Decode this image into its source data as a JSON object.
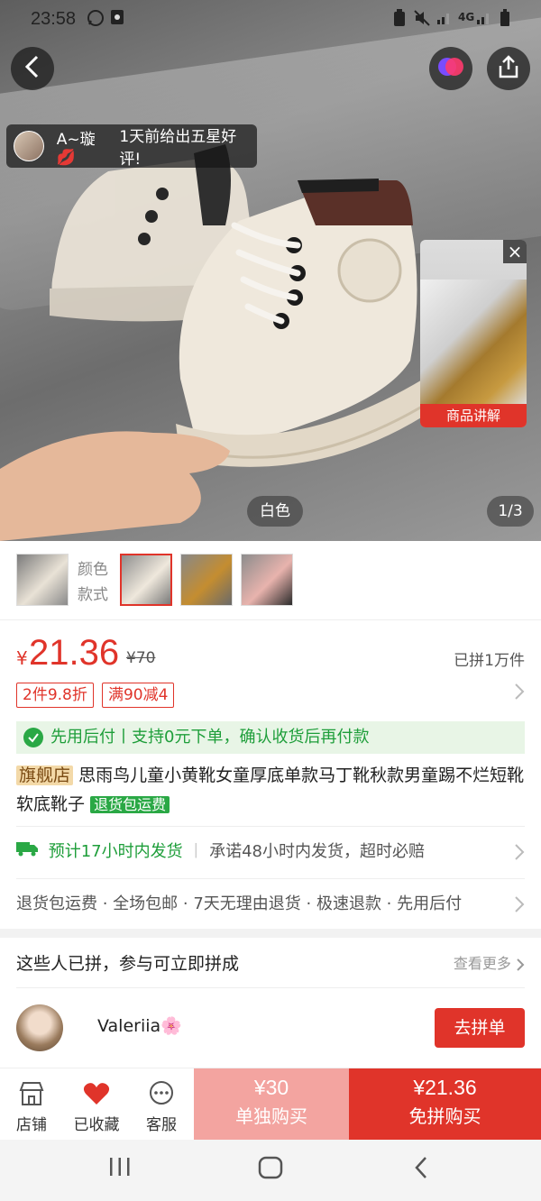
{
  "status_bar": {
    "time": "23:58",
    "icons": [
      "whatsapp-icon",
      "app-icon",
      "recycle-icon",
      "mute-icon",
      "signal-icon",
      "4g-icon",
      "signal-icon",
      "battery-icon"
    ],
    "network": "4G"
  },
  "hero": {
    "review_user": "A~璇💋",
    "review_text": "1天前给出五星好评!",
    "color_tag": "白色",
    "counter": "1/3",
    "video_label": "商品讲解",
    "video_close": "×"
  },
  "thumbs": {
    "label_line1": "颜色",
    "label_line2": "款式",
    "selected_index": 1
  },
  "price": {
    "currency": "¥",
    "current": "21.36",
    "original": "¥70",
    "group_count": "已拼1万件",
    "promos": [
      "2件9.8折",
      "满90减4"
    ]
  },
  "pay_banner": "先用后付丨支持0元下单，确认收货后再付款",
  "product": {
    "shop_tag": "旗舰店",
    "title": "思雨鸟儿童小黄靴女童厚底单款马丁靴秋款男童踢不烂短靴软底靴子",
    "return_tag": "退货包运费"
  },
  "shipping": {
    "estimate": "预计17小时内发货",
    "promise": "承诺48小时内发货，超时必赔"
  },
  "services": "退货包运费 · 全场包邮 · 7天无理由退货 · 极速退款 · 先用后付",
  "group_section": {
    "title": "这些人已拼，参与可立即拼成",
    "more": "查看更多",
    "member_name": "Valeriia🌸",
    "join_label": "去拼单"
  },
  "bottom_bar": {
    "shop": "店铺",
    "favorited": "已收藏",
    "service": "客服",
    "single_price": "¥30",
    "single_label": "单独购买",
    "group_price": "¥21.36",
    "group_label": "免拼购买"
  },
  "colors": {
    "accent": "#e0342a",
    "green": "#2aa845",
    "single_buy_bg": "#f3a4a0"
  }
}
